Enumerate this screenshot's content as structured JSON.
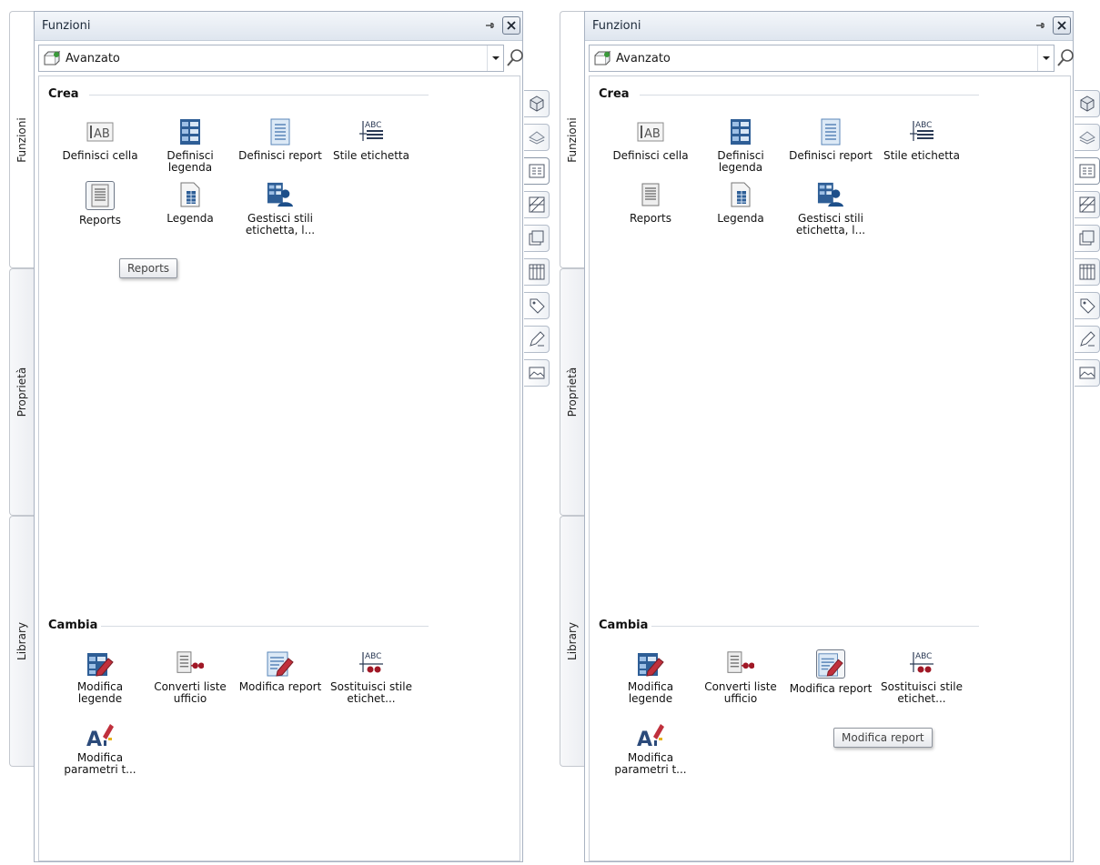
{
  "panes": [
    {
      "side_tabs": [
        "Funzioni",
        "Proprietà",
        "Library"
      ],
      "title": "Funzioni",
      "dropdown_value": "Avanzato",
      "sections": {
        "crea": {
          "title": "Crea",
          "items": [
            {
              "label": "Definisci cella",
              "icon": "cell-ab-icon"
            },
            {
              "label": "Definisci legenda",
              "icon": "legend-icon"
            },
            {
              "label": "Definisci report",
              "icon": "report-doc-icon"
            },
            {
              "label": "Stile etichetta",
              "icon": "label-style-abc-icon"
            },
            {
              "label": "Reports",
              "icon": "reports-icon"
            },
            {
              "label": "Legenda",
              "icon": "legend-doc-icon"
            },
            {
              "label": "Gestisci stili etichetta, l...",
              "icon": "manage-label-styles-icon"
            }
          ]
        },
        "cambia": {
          "title": "Cambia",
          "items": [
            {
              "label": "Modifica legende",
              "icon": "edit-legend-icon"
            },
            {
              "label": "Converti liste ufficio",
              "icon": "convert-lists-icon"
            },
            {
              "label": "Modifica report",
              "icon": "edit-report-icon"
            },
            {
              "label": "Sostituisci stile etichet...",
              "icon": "replace-label-style-icon"
            },
            {
              "label": "Modifica parametri t...",
              "icon": "edit-text-params-icon"
            }
          ]
        }
      },
      "selected_item": "Reports",
      "tooltip": "Reports"
    },
    {
      "side_tabs": [
        "Funzioni",
        "Proprietà",
        "Library"
      ],
      "title": "Funzioni",
      "dropdown_value": "Avanzato",
      "sections": {
        "crea": {
          "title": "Crea",
          "items": [
            {
              "label": "Definisci cella",
              "icon": "cell-ab-icon"
            },
            {
              "label": "Definisci legenda",
              "icon": "legend-icon"
            },
            {
              "label": "Definisci report",
              "icon": "report-doc-icon"
            },
            {
              "label": "Stile etichetta",
              "icon": "label-style-abc-icon"
            },
            {
              "label": "Reports",
              "icon": "reports-icon"
            },
            {
              "label": "Legenda",
              "icon": "legend-doc-icon"
            },
            {
              "label": "Gestisci stili etichetta, l...",
              "icon": "manage-label-styles-icon"
            }
          ]
        },
        "cambia": {
          "title": "Cambia",
          "items": [
            {
              "label": "Modifica legende",
              "icon": "edit-legend-icon"
            },
            {
              "label": "Converti liste ufficio",
              "icon": "convert-lists-icon"
            },
            {
              "label": "Modifica report",
              "icon": "edit-report-icon"
            },
            {
              "label": "Sostituisci stile etichet...",
              "icon": "replace-label-style-icon"
            },
            {
              "label": "Modifica parametri t...",
              "icon": "edit-text-params-icon"
            }
          ]
        }
      },
      "selected_item": "Modifica report",
      "tooltip": "Modifica report"
    }
  ],
  "side_toolbar_icons": [
    "3d-cube-icon",
    "surface-icon",
    "report-tab-icon",
    "hatch-icon",
    "layers-icon",
    "grid-icon",
    "tag-icon",
    "pen-icon",
    "landscape-icon"
  ],
  "colors": {
    "accent_blue": "#2f6aa8",
    "edit_red": "#c0303c",
    "panel_border": "#a9b3c2"
  }
}
